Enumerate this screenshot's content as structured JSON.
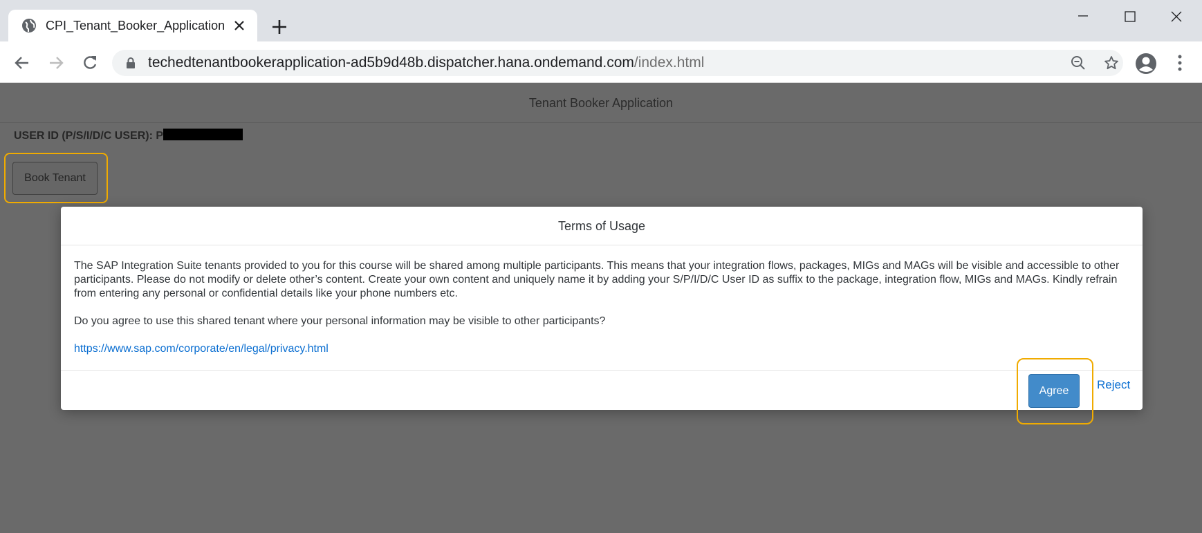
{
  "browser": {
    "tab_title": "CPI_Tenant_Booker_Application",
    "url_host": "techedtenantbookerapplication-ad5b9d48b.dispatcher.hana.ondemand.com",
    "url_path": "/index.html"
  },
  "app": {
    "title": "Tenant Booker Application",
    "user_id_label": "USER ID (P/S/I/D/C USER): P",
    "book_button": "Book Tenant"
  },
  "dialog": {
    "title": "Terms of Usage",
    "paragraph": "The SAP Integration Suite tenants provided to you for this course will be shared among multiple participants. This means that your integration flows, packages, MIGs and MAGs will be visible and accessible to other participants. Please do not modify or delete other’s content. Create your own content and uniquely name it by adding your S/P/I/D/C User ID as suffix to the package, integration flow, MIGs and MAGs. Kindly refrain from entering any personal or confidential details like your phone numbers etc.",
    "question": "Do you agree to use this shared tenant where your personal information may be visible to other participants?",
    "link": "https://www.sap.com/corporate/en/legal/privacy.html",
    "agree": "Agree",
    "reject": "Reject"
  },
  "colors": {
    "highlight": "#f0ab00",
    "agree_bg": "#428bca",
    "link": "#0a6ed1",
    "overlay": "#6a6a6a"
  }
}
